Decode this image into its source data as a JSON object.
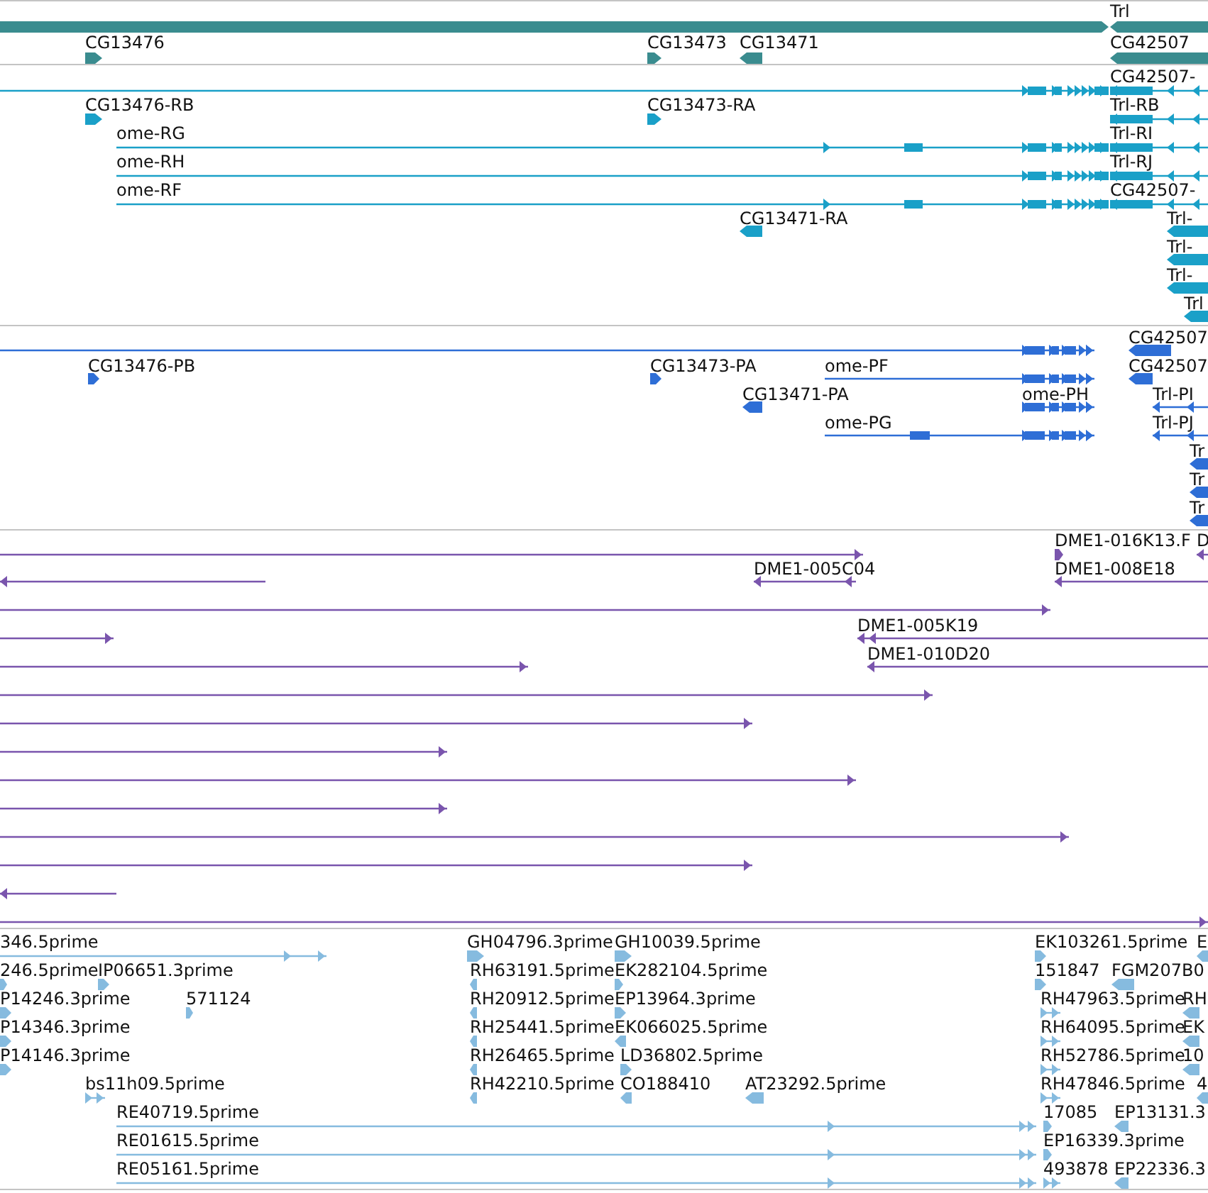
{
  "tracks": [
    {
      "kind": "genes",
      "color": "#3a8c8f",
      "features": [
        {
          "reverse": false
        },
        {
          "label": "Trl",
          "reverse": true
        },
        {
          "label": "CG13476",
          "reverse": false
        },
        {
          "label": "CG13473",
          "reverse": false
        },
        {
          "label": "CG13471",
          "reverse": true
        },
        {
          "label": "CG42507",
          "reverse": true
        }
      ]
    },
    {
      "kind": "transcripts",
      "color": "#1aa0c8",
      "features": [
        {
          "reverse": false
        },
        {
          "label": "CG42507-",
          "reverse": true
        },
        {
          "label": "CG13476-RB",
          "reverse": false
        },
        {
          "label": "CG13473-RA",
          "reverse": false
        },
        {
          "label": "Trl-RB",
          "reverse": true
        },
        {
          "label": "ome-RG",
          "reverse": false
        },
        {
          "label": "Trl-RI",
          "reverse": true
        },
        {
          "label": "ome-RH",
          "reverse": false
        },
        {
          "label": "Trl-RJ",
          "reverse": true
        },
        {
          "label": "ome-RF",
          "reverse": false
        },
        {
          "label": "CG42507-",
          "reverse": true
        },
        {
          "label": "CG13471-RA",
          "reverse": true
        },
        {
          "label": "Trl-",
          "reverse": true
        },
        {
          "label": "Trl-",
          "reverse": true
        },
        {
          "label": "Trl-",
          "reverse": true
        },
        {
          "label": "Trl",
          "reverse": true
        }
      ]
    },
    {
      "kind": "proteins",
      "color": "#2e6ed6",
      "features": [
        {
          "reverse": false
        },
        {
          "label": "CG42507",
          "reverse": true
        },
        {
          "label": "CG13476-PB",
          "reverse": false
        },
        {
          "label": "CG13473-PA",
          "reverse": false
        },
        {
          "label": "ome-PF",
          "reverse": false
        },
        {
          "label": "CG42507",
          "reverse": true
        },
        {
          "label": "CG13471-PA",
          "reverse": true
        },
        {
          "label": "ome-PH",
          "reverse": false
        },
        {
          "label": "Trl-PI",
          "reverse": true
        },
        {
          "label": "ome-PG",
          "reverse": false
        },
        {
          "label": "Trl-PJ",
          "reverse": true
        },
        {
          "label": "Tr",
          "reverse": true
        },
        {
          "label": "Tr",
          "reverse": true
        },
        {
          "label": "Tr",
          "reverse": true
        }
      ]
    },
    {
      "kind": "clones",
      "color": "#7a55ad",
      "features": [
        {
          "reverse": false
        },
        {
          "label": "DME1-016K13.F",
          "reverse": false
        },
        {
          "label": "D",
          "reverse": true
        },
        {
          "label": "DME1-005C04",
          "reverse": true
        },
        {
          "reverse": true
        },
        {
          "label": "DME1-008E18",
          "reverse": true
        },
        {
          "reverse": false
        },
        {
          "label": "DME1-005K19",
          "reverse": true
        },
        {
          "reverse": false
        },
        {
          "label": "DME1-010D20",
          "reverse": true
        },
        {
          "reverse": false
        },
        {
          "reverse": false
        },
        {
          "reverse": false
        },
        {
          "reverse": false
        },
        {
          "reverse": false
        },
        {
          "reverse": false
        },
        {
          "reverse": false
        },
        {
          "reverse": false
        },
        {
          "reverse": true
        },
        {
          "reverse": false
        }
      ]
    },
    {
      "kind": "ests",
      "color": "#86bbdf",
      "features": [
        {
          "label": "346.5prime",
          "reverse": false
        },
        {
          "label": "GH04796.3prime",
          "reverse": false
        },
        {
          "label": "GH10039.5prime",
          "reverse": false
        },
        {
          "label": "EK103261.5prime",
          "reverse": false
        },
        {
          "label": "E",
          "reverse": true
        },
        {
          "label": "246.5prime",
          "reverse": false
        },
        {
          "label": "IP06651.3prime",
          "reverse": false
        },
        {
          "label": "RH63191.5prime",
          "reverse": true
        },
        {
          "label": "EK282104.5prime",
          "reverse": false
        },
        {
          "label": "151847",
          "reverse": false
        },
        {
          "label": "FGM207B0",
          "reverse": true
        },
        {
          "label": "P14246.3prime",
          "reverse": false
        },
        {
          "label": "571124",
          "reverse": false
        },
        {
          "label": "RH20912.5prime",
          "reverse": true
        },
        {
          "label": "EP13964.3prime",
          "reverse": false
        },
        {
          "label": "RH47963.5prime",
          "reverse": false
        },
        {
          "label": "RH",
          "reverse": true
        },
        {
          "label": "P14346.3prime",
          "reverse": false
        },
        {
          "label": "RH25441.5prime",
          "reverse": true
        },
        {
          "label": "EK066025.5prime",
          "reverse": true
        },
        {
          "label": "RH64095.5prime",
          "reverse": false
        },
        {
          "label": "EK",
          "reverse": true
        },
        {
          "label": "P14146.3prime",
          "reverse": false
        },
        {
          "label": "RH26465.5prime",
          "reverse": true
        },
        {
          "label": "LD36802.5prime",
          "reverse": false
        },
        {
          "label": "RH52786.5prime",
          "reverse": false
        },
        {
          "label": "10",
          "reverse": true
        },
        {
          "label": "bs11h09.5prime",
          "reverse": false
        },
        {
          "label": "RH42210.5prime",
          "reverse": true
        },
        {
          "label": "CO188410",
          "reverse": true
        },
        {
          "label": "AT23292.5prime",
          "reverse": true
        },
        {
          "label": "RH47846.5prime",
          "reverse": false
        },
        {
          "label": "4",
          "reverse": true
        },
        {
          "label": "RE40719.5prime",
          "reverse": false
        },
        {
          "label": "17085",
          "reverse": false
        },
        {
          "label": "EP13131.3",
          "reverse": true
        },
        {
          "label": "RE01615.5prime",
          "reverse": false
        },
        {
          "label": "EP16339.3prime",
          "reverse": false
        },
        {
          "label": "RE05161.5prime",
          "reverse": false
        },
        {
          "label": "493878",
          "reverse": false
        },
        {
          "label": "EP22336.3",
          "reverse": true
        }
      ]
    }
  ]
}
